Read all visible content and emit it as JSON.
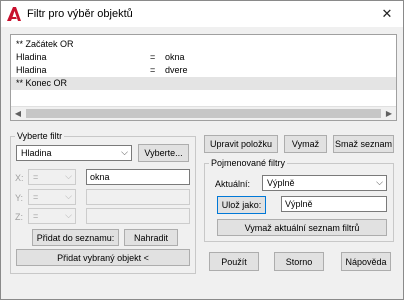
{
  "window": {
    "title": "Filtr pro výběr objektů",
    "close_glyph": "✕"
  },
  "list": {
    "rows": [
      {
        "c1": "** Začátek OR",
        "c2": "",
        "c3": "",
        "selected": false
      },
      {
        "c1": "Hladina",
        "c2": "=",
        "c3": "okna",
        "selected": false
      },
      {
        "c1": "Hladina",
        "c2": "=",
        "c3": "dvere",
        "selected": false
      },
      {
        "c1": "** Konec   OR",
        "c2": "",
        "c3": "",
        "selected": true
      }
    ]
  },
  "select_filter": {
    "label": "Vyberte filtr",
    "type_value": "Hladina",
    "select_button": "Vyberte...",
    "x_label": "X:",
    "y_label": "Y:",
    "z_label": "Z:",
    "x_op": "=",
    "y_op": "=",
    "z_op": "=",
    "x_value": "okna",
    "y_value": "",
    "z_value": "",
    "add_to_list_button": "Přidat do seznamu:",
    "replace_button": "Nahradit",
    "add_selected_button": "Přidat vybraný objekt <"
  },
  "actions": {
    "edit_item": "Upravit položku",
    "delete": "Vymaž",
    "clear_list": "Smaž seznam"
  },
  "named_filters": {
    "label": "Pojmenované filtry",
    "current_label": "Aktuální:",
    "current_value": "Výplně",
    "save_as_button": "Ulož jako:",
    "save_as_value": "Výplně",
    "delete_current_button": "Vymaž aktuální seznam filtrů"
  },
  "footer": {
    "apply": "Použít",
    "cancel": "Storno",
    "help": "Nápověda"
  },
  "colors": {
    "accent": "#0078d7",
    "app_icon": "#c8102e"
  }
}
